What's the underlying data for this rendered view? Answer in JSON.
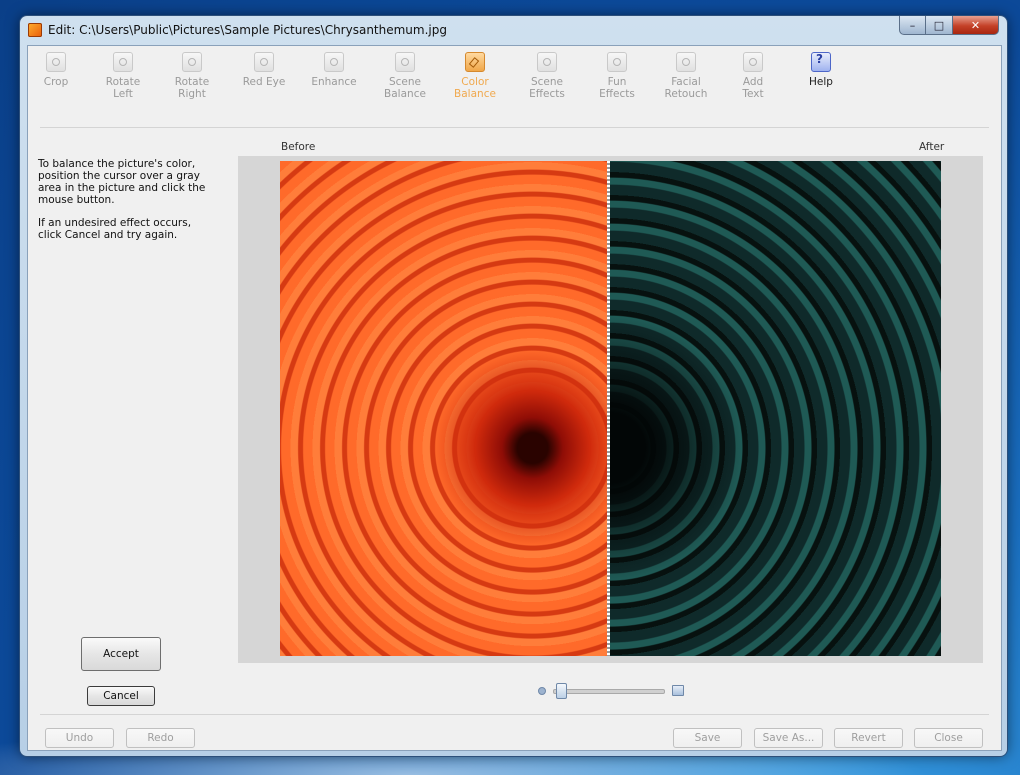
{
  "window": {
    "title": "Edit: C:\\Users\\Public\\Pictures\\Sample Pictures\\Chrysanthemum.jpg",
    "minimize_label": "–",
    "maximize_label": "□",
    "close_label": "✕"
  },
  "toolbar": {
    "crop": "Crop",
    "rotate_left": "Rotate\nLeft",
    "rotate_right": "Rotate\nRight",
    "red_eye": "Red Eye",
    "enhance": "Enhance",
    "scene_balance": "Scene\nBalance",
    "color_balance": "Color\nBalance",
    "scene_effects": "Scene\nEffects",
    "fun_effects": "Fun\nEffects",
    "facial_retouch": "Facial\nRetouch",
    "add_text": "Add\nText",
    "help": "Help",
    "active_tool": "color_balance"
  },
  "instructions": {
    "line1": "To balance the picture's color, position the cursor over a gray area in the picture and click the mouse button.",
    "line2": "If an undesired effect occurs, click Cancel and try again."
  },
  "preview": {
    "before_label": "Before",
    "after_label": "After"
  },
  "zoom": {
    "level": 0.03
  },
  "actions": {
    "accept": "Accept",
    "cancel": "Cancel",
    "undo": "Undo",
    "redo": "Redo",
    "save": "Save",
    "save_as": "Save As...",
    "revert": "Revert",
    "close": "Close"
  },
  "colors": {
    "accent_active": "#f0a94f",
    "disabled_text": "#9a9a9a",
    "close_button": "#c44128"
  }
}
